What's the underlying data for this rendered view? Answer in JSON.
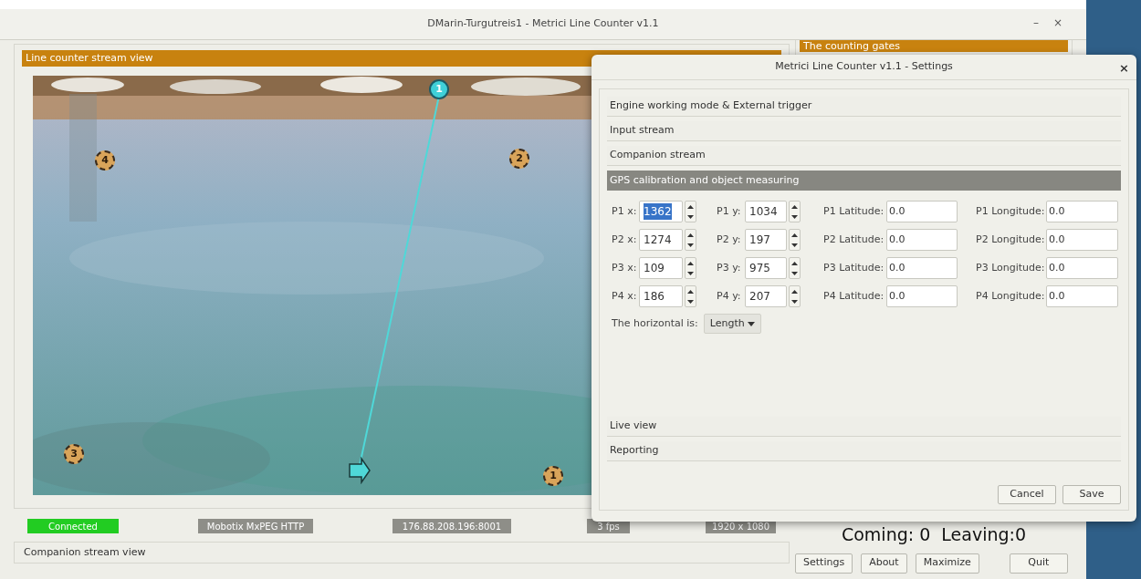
{
  "window": {
    "title": "DMarin-Turgutreis1 - Metrici Line Counter v1.1",
    "minimize": "–",
    "close": "×"
  },
  "stream_view": {
    "title": "Line counter stream view",
    "markers": [
      {
        "label": "1",
        "kind": "gate"
      },
      {
        "label": "4",
        "kind": "point"
      },
      {
        "label": "2",
        "kind": "point"
      },
      {
        "label": "3",
        "kind": "point"
      },
      {
        "label": "1",
        "kind": "point"
      }
    ]
  },
  "status": [
    {
      "text": "Connected",
      "kind": "ok"
    },
    {
      "text": "Mobotix MxPEG HTTP",
      "kind": "info"
    },
    {
      "text": "176.88.208.196:8001",
      "kind": "info"
    },
    {
      "text": "3 fps",
      "kind": "info"
    },
    {
      "text": "1920 x 1080",
      "kind": "info"
    }
  ],
  "companion_view": {
    "title": "Companion stream view"
  },
  "gates_panel": {
    "title": "The counting gates",
    "counter": "Coming: 0  Leaving:0"
  },
  "buttons": [
    "Settings",
    "About",
    "Maximize",
    "Quit"
  ],
  "dialog": {
    "title": "Metrici Line Counter v1.1 - Settings",
    "close": "×",
    "sections": [
      {
        "label": "Engine working mode & External trigger",
        "expanded": false
      },
      {
        "label": "Input stream",
        "expanded": false
      },
      {
        "label": "Companion stream",
        "expanded": false
      },
      {
        "label": "GPS calibration and object measuring",
        "expanded": true
      },
      {
        "label": "Live view",
        "expanded": false
      },
      {
        "label": "Reporting",
        "expanded": false
      }
    ],
    "points": [
      {
        "x_label": "P1 x:",
        "x_value": "1362",
        "x_highlighted": true,
        "y_label": "P1 y:",
        "y_value": "1034",
        "lat_label": "P1 Latitude:",
        "lat_value": "0.0",
        "lon_label": "P1 Longitude:",
        "lon_value": "0.0"
      },
      {
        "x_label": "P2 x:",
        "x_value": "1274",
        "x_highlighted": false,
        "y_label": "P2 y:",
        "y_value": "197",
        "lat_label": "P2 Latitude:",
        "lat_value": "0.0",
        "lon_label": "P2 Longitude:",
        "lon_value": "0.0"
      },
      {
        "x_label": "P3 x:",
        "x_value": "109",
        "x_highlighted": false,
        "y_label": "P3 y:",
        "y_value": "975",
        "lat_label": "P3 Latitude:",
        "lat_value": "0.0",
        "lon_label": "P3 Longitude:",
        "lon_value": "0.0"
      },
      {
        "x_label": "P4 x:",
        "x_value": "186",
        "x_highlighted": false,
        "y_label": "P4 y:",
        "y_value": "207",
        "lat_label": "P4 Latitude:",
        "lat_value": "0.0",
        "lon_label": "P4 Longitude:",
        "lon_value": "0.0"
      }
    ],
    "horizontal": {
      "label": "The horizontal is:",
      "value": "Length"
    },
    "buttons": [
      "Cancel",
      "Save"
    ]
  }
}
